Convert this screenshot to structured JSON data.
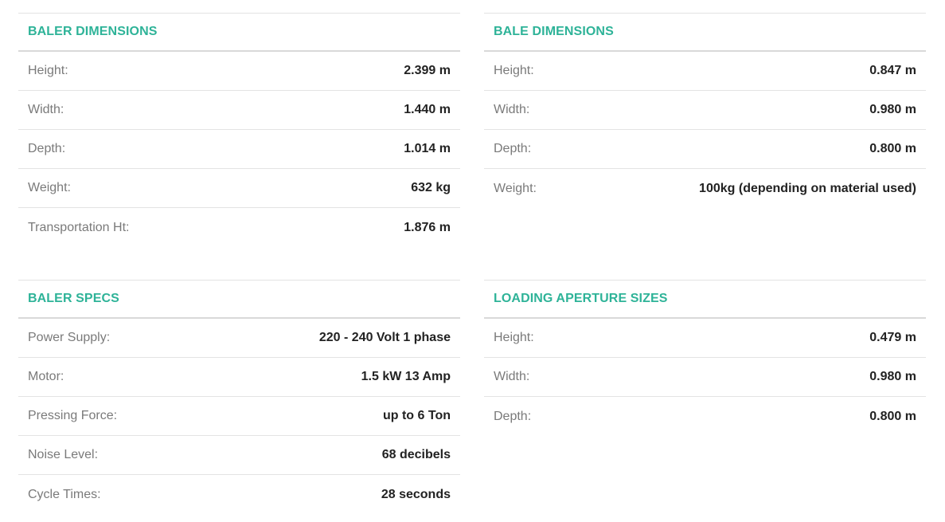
{
  "baler_dimensions": {
    "title": "BALER DIMENSIONS",
    "rows": [
      {
        "label": "Height:",
        "value": "2.399 m"
      },
      {
        "label": "Width:",
        "value": "1.440 m"
      },
      {
        "label": "Depth:",
        "value": "1.014 m"
      },
      {
        "label": "Weight:",
        "value": "632 kg"
      },
      {
        "label": "Transportation Ht:",
        "value": "1.876 m"
      }
    ]
  },
  "bale_dimensions": {
    "title": "BALE DIMENSIONS",
    "rows": [
      {
        "label": "Height:",
        "value": "0.847 m"
      },
      {
        "label": "Width:",
        "value": "0.980 m"
      },
      {
        "label": "Depth:",
        "value": "0.800 m"
      },
      {
        "label": "Weight:",
        "value": "100kg (depending on material used)"
      }
    ]
  },
  "baler_specs": {
    "title": "BALER SPECS",
    "rows": [
      {
        "label": "Power Supply:",
        "value": "220 - 240 Volt 1 phase"
      },
      {
        "label": "Motor:",
        "value": "1.5 kW 13 Amp"
      },
      {
        "label": "Pressing Force:",
        "value": "up to 6 Ton"
      },
      {
        "label": "Noise Level:",
        "value": "68 decibels"
      },
      {
        "label": "Cycle Times:",
        "value": "28 seconds"
      }
    ]
  },
  "loading_aperture_sizes": {
    "title": "LOADING APERTURE SIZES",
    "rows": [
      {
        "label": "Height:",
        "value": "0.479 m"
      },
      {
        "label": "Width:",
        "value": "0.980 m"
      },
      {
        "label": "Depth:",
        "value": "0.800 m"
      }
    ]
  },
  "colors": {
    "heading_accent": "#2eb398",
    "label_text": "#7a7a7a",
    "value_text": "#222222",
    "divider": "#e3e3e3"
  }
}
